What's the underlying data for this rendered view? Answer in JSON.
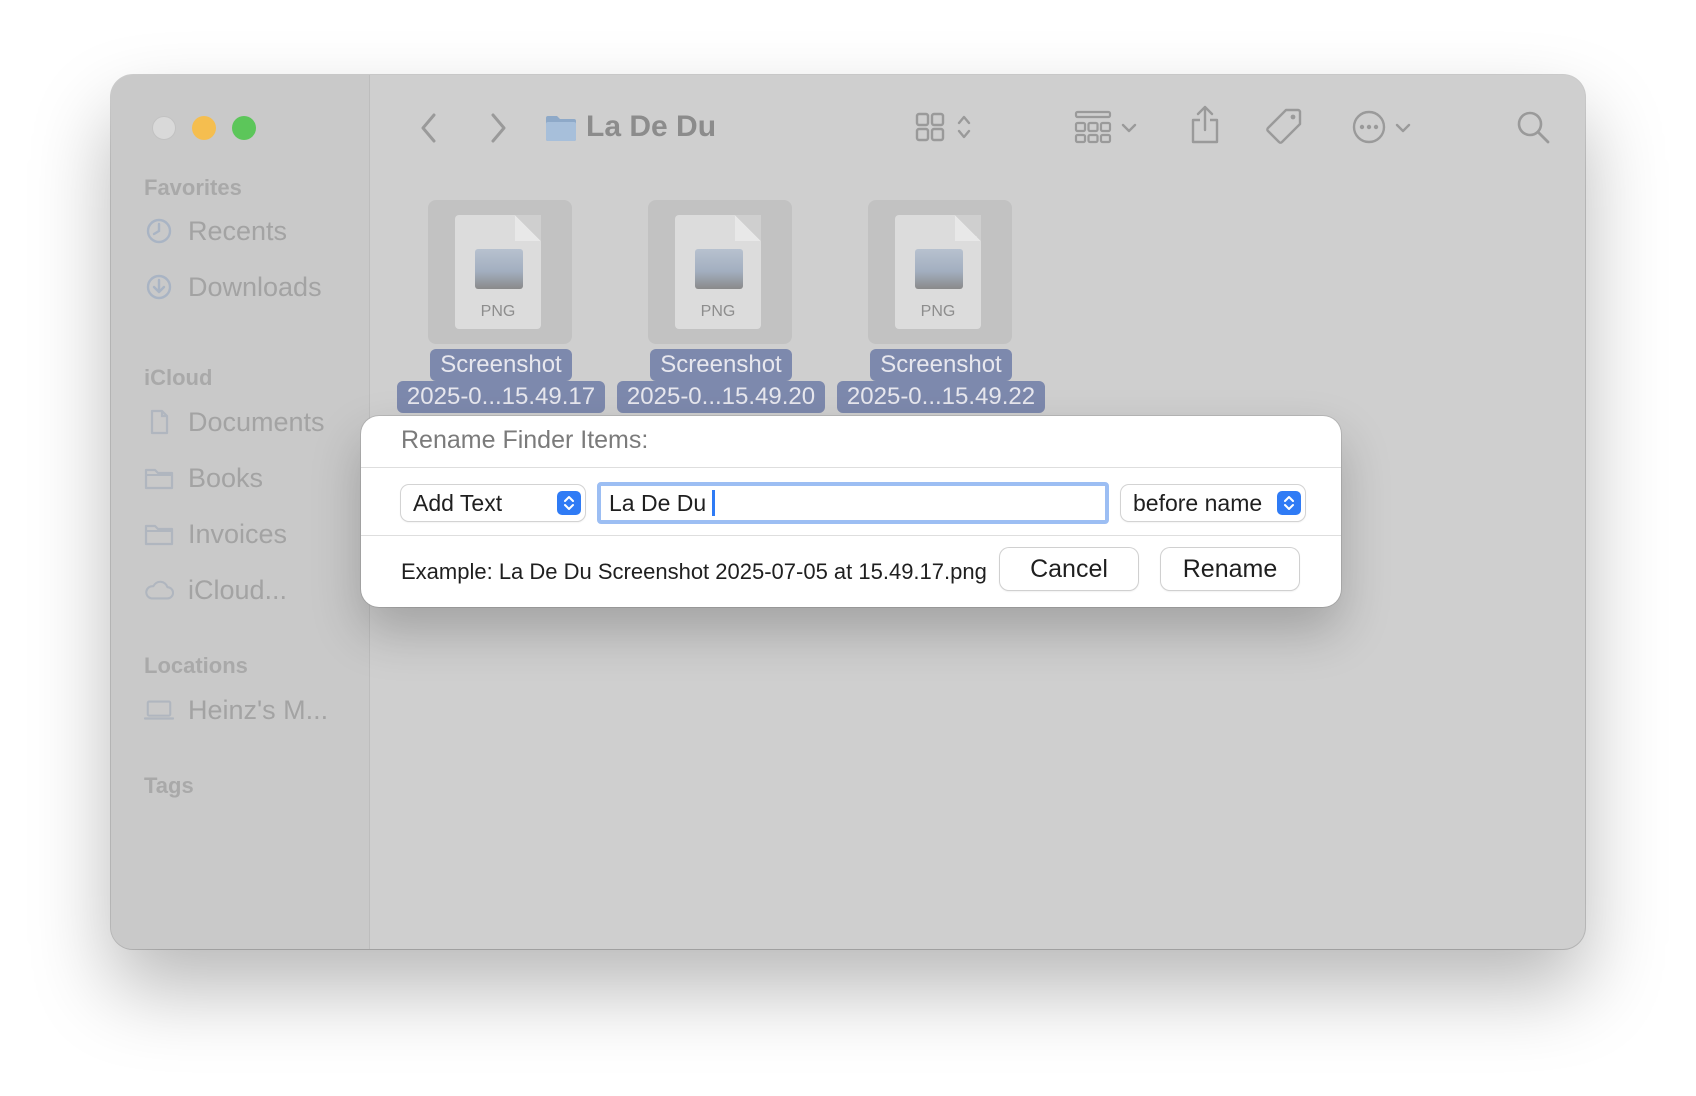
{
  "window": {
    "title": "La De Du"
  },
  "sidebar": {
    "sections": [
      {
        "heading": "Favorites",
        "items": [
          {
            "label": "Recents",
            "icon": "clock-icon"
          },
          {
            "label": "Downloads",
            "icon": "download-icon"
          }
        ]
      },
      {
        "heading": "iCloud",
        "items": [
          {
            "label": "Documents",
            "icon": "document-icon"
          },
          {
            "label": "Books",
            "icon": "folder-icon"
          },
          {
            "label": "Invoices",
            "icon": "folder-icon"
          },
          {
            "label": "iCloud...",
            "icon": "cloud-icon"
          }
        ]
      },
      {
        "heading": "Locations",
        "items": [
          {
            "label": "Heinz's M...",
            "icon": "laptop-icon"
          }
        ]
      },
      {
        "heading": "Tags",
        "items": []
      }
    ]
  },
  "files": [
    {
      "type_label": "PNG",
      "name_line1": "Screenshot",
      "name_line2": "2025-0...15.49.17"
    },
    {
      "type_label": "PNG",
      "name_line1": "Screenshot",
      "name_line2": "2025-0...15.49.20"
    },
    {
      "type_label": "PNG",
      "name_line1": "Screenshot",
      "name_line2": "2025-0...15.49.22"
    }
  ],
  "dialog": {
    "title": "Rename Finder Items:",
    "mode": "Add Text",
    "text_value": "La De Du",
    "position": "before name",
    "example": "Example: La De Du Screenshot 2025-07-05 at 15.49.17.png",
    "cancel_label": "Cancel",
    "rename_label": "Rename"
  },
  "colors": {
    "accent": "#2f7bf5",
    "selection": "#7d89ad",
    "traffic_minimize": "#f5be4f",
    "traffic_maximize": "#5cc65a"
  }
}
